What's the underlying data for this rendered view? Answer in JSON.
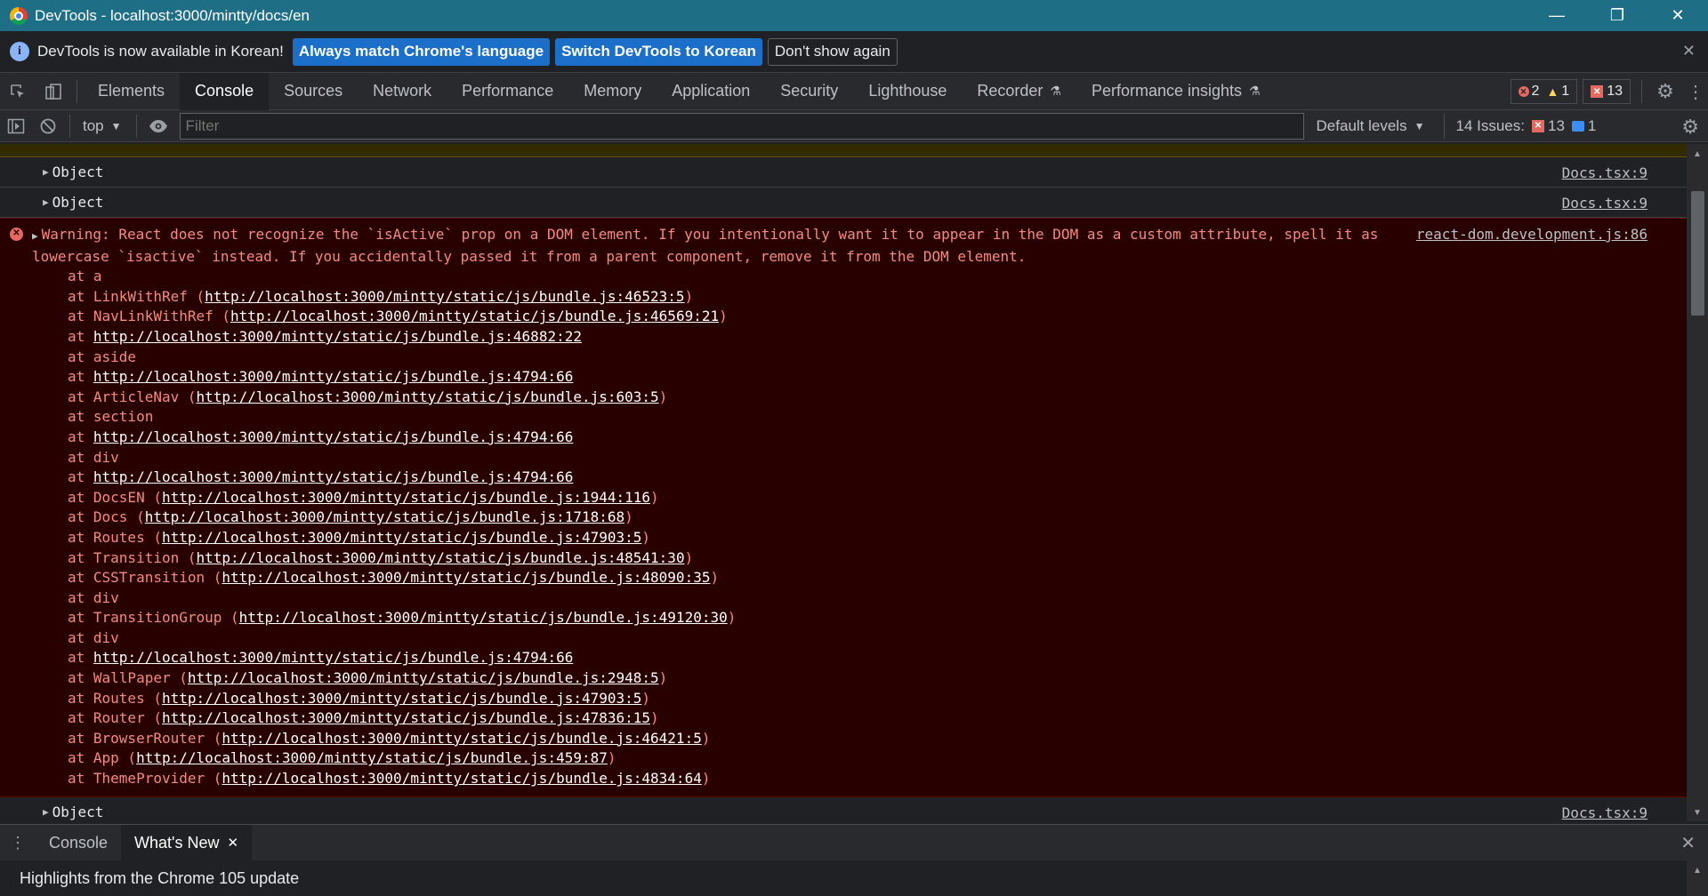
{
  "window": {
    "title": "DevTools - localhost:3000/mintty/docs/en",
    "minimize": "—",
    "restore": "❐",
    "close": "✕"
  },
  "infobar": {
    "message": "DevTools is now available in Korean!",
    "btn_match": "Always match Chrome's language",
    "btn_switch": "Switch DevTools to Korean",
    "btn_dismiss": "Don't show again"
  },
  "tabs": {
    "elements": "Elements",
    "console": "Console",
    "sources": "Sources",
    "network": "Network",
    "performance": "Performance",
    "memory": "Memory",
    "application": "Application",
    "security": "Security",
    "lighthouse": "Lighthouse",
    "recorder": "Recorder",
    "perf_insights": "Performance insights"
  },
  "counts": {
    "errors": "2",
    "warnings": "1",
    "issues_badge": "13"
  },
  "console_toolbar": {
    "context": "top",
    "filter_placeholder": "Filter",
    "levels": "Default levels",
    "issues_label": "14 Issues:",
    "issues_errors": "13",
    "issues_info": "1"
  },
  "messages": {
    "object1": {
      "text": "Object",
      "source": "Docs.tsx:9"
    },
    "object2": {
      "text": "Object",
      "source": "Docs.tsx:9"
    },
    "object3": {
      "text": "Object",
      "source": "Docs.tsx:9"
    },
    "warning": {
      "source": "react-dom.development.js:86",
      "text": "Warning: React does not recognize the `isActive` prop on a DOM element. If you intentionally want it to appear in the DOM as a custom attribute, spell it as lowercase `isactive` instead. If you accidentally passed it from a parent component, remove it from the DOM element.",
      "stack": [
        {
          "pre": "at a",
          "url": "",
          "post": ""
        },
        {
          "pre": "at LinkWithRef (",
          "url": "http://localhost:3000/mintty/static/js/bundle.js:46523:5",
          "post": ")"
        },
        {
          "pre": "at NavLinkWithRef (",
          "url": "http://localhost:3000/mintty/static/js/bundle.js:46569:21",
          "post": ")"
        },
        {
          "pre": "at ",
          "url": "http://localhost:3000/mintty/static/js/bundle.js:46882:22",
          "post": ""
        },
        {
          "pre": "at aside",
          "url": "",
          "post": ""
        },
        {
          "pre": "at ",
          "url": "http://localhost:3000/mintty/static/js/bundle.js:4794:66",
          "post": ""
        },
        {
          "pre": "at ArticleNav (",
          "url": "http://localhost:3000/mintty/static/js/bundle.js:603:5",
          "post": ")"
        },
        {
          "pre": "at section",
          "url": "",
          "post": ""
        },
        {
          "pre": "at ",
          "url": "http://localhost:3000/mintty/static/js/bundle.js:4794:66",
          "post": ""
        },
        {
          "pre": "at div",
          "url": "",
          "post": ""
        },
        {
          "pre": "at ",
          "url": "http://localhost:3000/mintty/static/js/bundle.js:4794:66",
          "post": ""
        },
        {
          "pre": "at DocsEN (",
          "url": "http://localhost:3000/mintty/static/js/bundle.js:1944:116",
          "post": ")"
        },
        {
          "pre": "at Docs (",
          "url": "http://localhost:3000/mintty/static/js/bundle.js:1718:68",
          "post": ")"
        },
        {
          "pre": "at Routes (",
          "url": "http://localhost:3000/mintty/static/js/bundle.js:47903:5",
          "post": ")"
        },
        {
          "pre": "at Transition (",
          "url": "http://localhost:3000/mintty/static/js/bundle.js:48541:30",
          "post": ")"
        },
        {
          "pre": "at CSSTransition (",
          "url": "http://localhost:3000/mintty/static/js/bundle.js:48090:35",
          "post": ")"
        },
        {
          "pre": "at div",
          "url": "",
          "post": ""
        },
        {
          "pre": "at TransitionGroup (",
          "url": "http://localhost:3000/mintty/static/js/bundle.js:49120:30",
          "post": ")"
        },
        {
          "pre": "at div",
          "url": "",
          "post": ""
        },
        {
          "pre": "at ",
          "url": "http://localhost:3000/mintty/static/js/bundle.js:4794:66",
          "post": ""
        },
        {
          "pre": "at WallPaper (",
          "url": "http://localhost:3000/mintty/static/js/bundle.js:2948:5",
          "post": ")"
        },
        {
          "pre": "at Routes (",
          "url": "http://localhost:3000/mintty/static/js/bundle.js:47903:5",
          "post": ")"
        },
        {
          "pre": "at Router (",
          "url": "http://localhost:3000/mintty/static/js/bundle.js:47836:15",
          "post": ")"
        },
        {
          "pre": "at BrowserRouter (",
          "url": "http://localhost:3000/mintty/static/js/bundle.js:46421:5",
          "post": ")"
        },
        {
          "pre": "at App (",
          "url": "http://localhost:3000/mintty/static/js/bundle.js:459:87",
          "post": ")"
        },
        {
          "pre": "at ThemeProvider (",
          "url": "http://localhost:3000/mintty/static/js/bundle.js:4834:64",
          "post": ")"
        }
      ]
    }
  },
  "drawer": {
    "tab_console": "Console",
    "tab_whats_new": "What's New",
    "highlights": "Highlights from the Chrome 105 update"
  },
  "colors": {
    "titlebar": "#1e6f86",
    "error_bg": "#290000",
    "error_text": "#f28b82",
    "primary_button": "#1b6fc9"
  }
}
